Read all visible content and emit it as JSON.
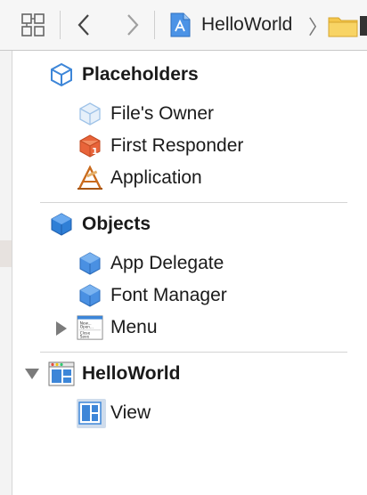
{
  "jumpbar": {
    "crumb_project": "HelloWorld",
    "crumb_separator": "〉"
  },
  "outline": {
    "placeholders": {
      "title": "Placeholders",
      "items": [
        "File's Owner",
        "First Responder",
        "Application"
      ]
    },
    "objects": {
      "title": "Objects",
      "items": [
        "App Delegate",
        "Font Manager",
        "Menu"
      ]
    },
    "window": {
      "title": "HelloWorld",
      "items": [
        "View"
      ]
    },
    "first_responder_badge": "1",
    "menu_thumb_lines": [
      "New...",
      "Open...",
      "Close",
      "Save"
    ]
  },
  "colors": {
    "accent_blue": "#3d86d8",
    "cube_blue": "#4a90e2",
    "responder_orange": "#e8643a"
  }
}
